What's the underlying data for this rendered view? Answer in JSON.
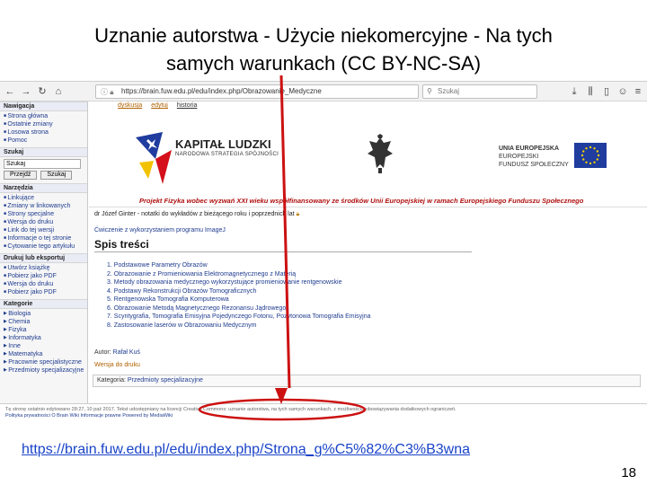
{
  "slide": {
    "title_line1": "Uznanie autorstwa - Użycie niekomercyjne - Na tych",
    "title_line2": "samych warunkach (CC BY-NC-SA)",
    "url": "https://brain.fuw.edu.pl/edu/index.php/Strona_g%C5%82%C3%B3wna",
    "page_number": "18"
  },
  "browser": {
    "address": "https://brain.fuw.edu.pl/edu/index.php/Obrazowanie_Medyczne",
    "search_placeholder": "Szukaj"
  },
  "sidebar": {
    "nav_heading": "Nawigacja",
    "nav_items": [
      "Strona główna",
      "Ostatnie zmiany",
      "Losowa strona",
      "Pomoc"
    ],
    "search_heading": "Szukaj",
    "search_value": "Szukaj",
    "go_button": "Przejdź",
    "search_button": "Szukaj",
    "tools_heading": "Narzędzia",
    "tools_items": [
      "Linkujące",
      "Zmiany w linkowanych",
      "Strony specjalne",
      "Wersja do druku",
      "Link do tej wersji",
      "Informacje o tej stronie",
      "Cytowanie tego artykułu"
    ],
    "print_heading": "Drukuj lub eksportuj",
    "print_items": [
      "Utwórz książkę",
      "Pobierz jako PDF",
      "Wersja do druku",
      "Pobierz jako PDF"
    ],
    "cat_heading": "Kategorie",
    "cat_items": [
      "Biologia",
      "Chemia",
      "Fizyka",
      "Informatyka",
      "Inne",
      "Matematyka",
      "Pracownie specjalistyczne",
      "Przedmioty specjalizacyjne"
    ]
  },
  "content": {
    "subnav": [
      "dyskusja",
      "edytuj",
      "historia"
    ],
    "logo_kl_title": "KAPITAŁ LUDZKI",
    "logo_kl_subtitle": "NARODOWA STRATEGIA SPÓJNOŚCI",
    "logo_ue_line1": "UNIA EUROPEJSKA",
    "logo_ue_line2": "EUROPEJSKI",
    "logo_ue_line3": "FUNDUSZ SPOŁECZNY",
    "project_line": "Projekt Fizyka wobec wyzwań XXI wieku współfinansowany ze środków Unii Europejskiej w ramach Europejskiego Funduszu Społecznego",
    "author_line": "dr Józef Ginter - notatki do wykładów z bieżącego roku i poprzednich lat",
    "link_line": "Ćwiczenie z wykorzystaniem programu ImageJ",
    "toc_title": "Spis treści",
    "toc": [
      "1. Podstawowe Parametry Obrazów",
      "2. Obrazowanie z Promieniowania Elektromagnetycznego z Materią",
      "3. Metody obrazowania medycznego wykorzystujące promieniowanie rentgenowskie",
      "4. Podstawy Rekonstrukcji Obrazów Tomograficznych",
      "5. Rentgenowska Tomografia Komputerowa",
      "6. Obrazowanie Metodą Magnetycznego Rezonansu Jądrowego",
      "7. Scyntygrafia, Tomografia Emisyjna Pojedynczego Fotonu, Pozytonowa Tomografia Emisyjna",
      "8. Zastosowanie laserów w Obrazowaniu Medycznym"
    ],
    "author_label": "Autor:",
    "author_name": "Rafał Kuś",
    "print_link": "Wersja do druku",
    "category_label": "Kategoria:",
    "category_value": "Przedmioty specjalizacyjne"
  },
  "footer": {
    "line1": "Tę stronę ostatnio edytowano 28:27, 10 paź 2017. Tekst udostępniany na licencji Creative Commons: uznanie autorstwa, na tych samych warunkach, z możliwością obowiązywania dodatkowych ograniczeń.",
    "line2": "Polityka prywatności   O Brain Wiki   Informacje prawne   Powered by MediaWiki"
  },
  "colors": {
    "annotation_red": "#cc1111",
    "link_blue": "#1f3c8f",
    "slide_url_blue": "#1a44c8"
  }
}
